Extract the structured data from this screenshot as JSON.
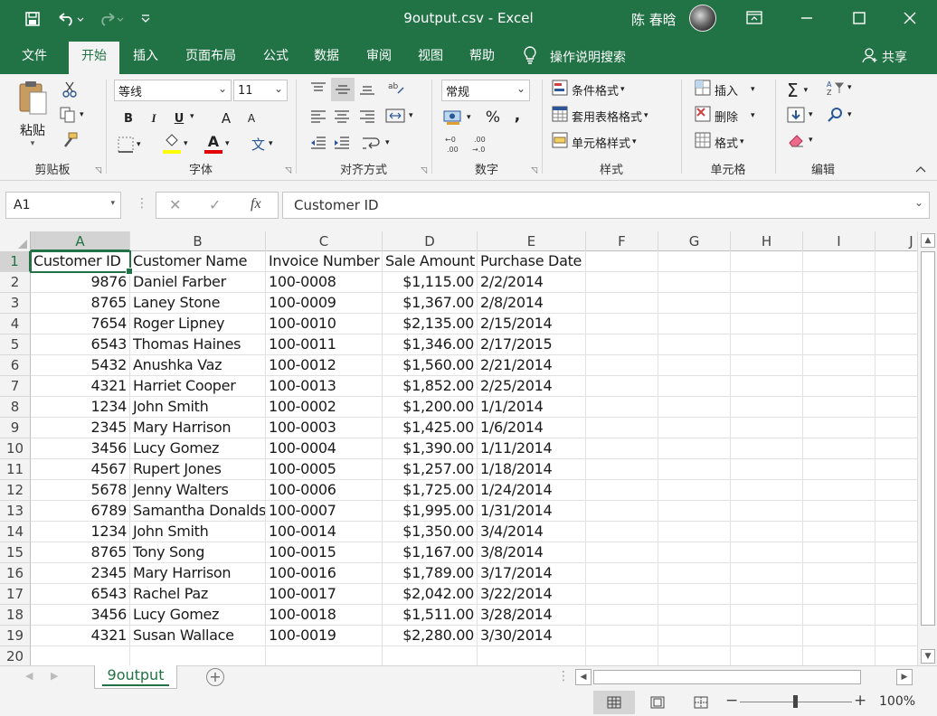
{
  "title_bar": {
    "doc_title": "9output.csv  -  Excel",
    "user_name": "陈 春晗",
    "icons": [
      "save-icon",
      "undo-icon",
      "redo-icon",
      "customize-qat-icon",
      "ribbon-display-icon",
      "minimize-icon",
      "maximize-icon",
      "close-icon"
    ]
  },
  "tabs": [
    {
      "label": "文件"
    },
    {
      "label": "开始"
    },
    {
      "label": "插入"
    },
    {
      "label": "页面布局"
    },
    {
      "label": "公式"
    },
    {
      "label": "数据"
    },
    {
      "label": "审阅"
    },
    {
      "label": "视图"
    },
    {
      "label": "帮助"
    }
  ],
  "tell_me": "操作说明搜索",
  "share": "共享",
  "ribbon": {
    "clipboard": {
      "paste": "粘贴",
      "label": "剪贴板"
    },
    "font": {
      "name": "等线",
      "size": "11",
      "label": "字体",
      "bold": "B",
      "italic": "I",
      "underline": "U",
      "grow": "A",
      "shrink": "A"
    },
    "alignment": {
      "label": "对齐方式"
    },
    "number": {
      "format": "常规",
      "label": "数字",
      "percent": "%",
      "comma": ","
    },
    "styles": {
      "conditional": "条件格式",
      "table": "套用表格格式",
      "cell": "单元格样式",
      "label": "样式"
    },
    "cells": {
      "insert": "插入",
      "delete": "删除",
      "format": "格式",
      "label": "单元格"
    },
    "editing": {
      "label": "编辑"
    }
  },
  "formula_bar": {
    "name_box": "A1",
    "cancel": "✕",
    "enter": "✓",
    "fx": "fx",
    "content": "Customer ID"
  },
  "columns": [
    "A",
    "B",
    "C",
    "D",
    "E",
    "F",
    "G",
    "H",
    "I",
    "J"
  ],
  "rows": [
    {
      "n": "1",
      "a": "Customer ID",
      "b": "Customer Name",
      "c": "Invoice Number",
      "d": "Sale Amount",
      "e": "Purchase Date"
    },
    {
      "n": "2",
      "a": "9876",
      "b": "Daniel Farber",
      "c": "100-0008",
      "d": "$1,115.00",
      "e": "2/2/2014"
    },
    {
      "n": "3",
      "a": "8765",
      "b": "Laney Stone",
      "c": "100-0009",
      "d": "$1,367.00",
      "e": "2/8/2014"
    },
    {
      "n": "4",
      "a": "7654",
      "b": "Roger Lipney",
      "c": "100-0010",
      "d": "$2,135.00",
      "e": "2/15/2014"
    },
    {
      "n": "5",
      "a": "6543",
      "b": "Thomas Haines",
      "c": "100-0011",
      "d": "$1,346.00",
      "e": "2/17/2015"
    },
    {
      "n": "6",
      "a": "5432",
      "b": "Anushka Vaz",
      "c": "100-0012",
      "d": "$1,560.00",
      "e": "2/21/2014"
    },
    {
      "n": "7",
      "a": "4321",
      "b": "Harriet Cooper",
      "c": "100-0013",
      "d": "$1,852.00",
      "e": "2/25/2014"
    },
    {
      "n": "8",
      "a": "1234",
      "b": "John Smith",
      "c": "100-0002",
      "d": "$1,200.00",
      "e": "1/1/2014"
    },
    {
      "n": "9",
      "a": "2345",
      "b": "Mary Harrison",
      "c": "100-0003",
      "d": "$1,425.00",
      "e": "1/6/2014"
    },
    {
      "n": "10",
      "a": "3456",
      "b": "Lucy Gomez",
      "c": "100-0004",
      "d": "$1,390.00",
      "e": "1/11/2014"
    },
    {
      "n": "11",
      "a": "4567",
      "b": "Rupert Jones",
      "c": "100-0005",
      "d": "$1,257.00",
      "e": "1/18/2014"
    },
    {
      "n": "12",
      "a": "5678",
      "b": "Jenny Walters",
      "c": "100-0006",
      "d": "$1,725.00",
      "e": "1/24/2014"
    },
    {
      "n": "13",
      "a": "6789",
      "b": "Samantha Donaldson",
      "c": "100-0007",
      "d": "$1,995.00",
      "e": "1/31/2014"
    },
    {
      "n": "14",
      "a": "1234",
      "b": "John Smith",
      "c": "100-0014",
      "d": "$1,350.00",
      "e": "3/4/2014"
    },
    {
      "n": "15",
      "a": "8765",
      "b": "Tony Song",
      "c": "100-0015",
      "d": "$1,167.00",
      "e": "3/8/2014"
    },
    {
      "n": "16",
      "a": "2345",
      "b": "Mary Harrison",
      "c": "100-0016",
      "d": "$1,789.00",
      "e": "3/17/2014"
    },
    {
      "n": "17",
      "a": "6543",
      "b": "Rachel Paz",
      "c": "100-0017",
      "d": "$2,042.00",
      "e": "3/22/2014"
    },
    {
      "n": "18",
      "a": "3456",
      "b": "Lucy Gomez",
      "c": "100-0018",
      "d": "$1,511.00",
      "e": "3/28/2014"
    },
    {
      "n": "19",
      "a": "4321",
      "b": "Susan Wallace",
      "c": "100-0019",
      "d": "$2,280.00",
      "e": "3/30/2014"
    },
    {
      "n": "20",
      "a": "",
      "b": "",
      "c": "",
      "d": "",
      "e": ""
    }
  ],
  "sheet_tab": "9output",
  "status": {
    "zoom": "100%",
    "zoom_minus": "−",
    "zoom_plus": "+"
  },
  "colors": {
    "accent": "#217346",
    "ribbon_bg": "#f3f3f3",
    "font_color_bar": "#e00000",
    "highlight_bar": "#ffff00"
  }
}
